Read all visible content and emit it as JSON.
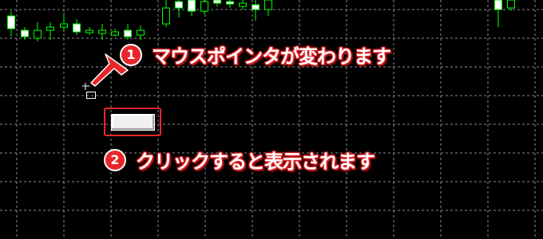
{
  "chart": {
    "background_color": "#000000",
    "grid_color": "#8a8a8a",
    "bull_color": "#00ff00",
    "bear_color": "#ffffff"
  },
  "annotations": {
    "step1": {
      "number": "1",
      "text": "マウスポインタが変わります"
    },
    "step2": {
      "number": "2",
      "text": "クリックすると表示されます"
    },
    "accent_color": "#e8262a"
  },
  "cursor": {
    "icon": "crosshair-rectangle-cursor-icon"
  },
  "button": {
    "label": ""
  }
}
